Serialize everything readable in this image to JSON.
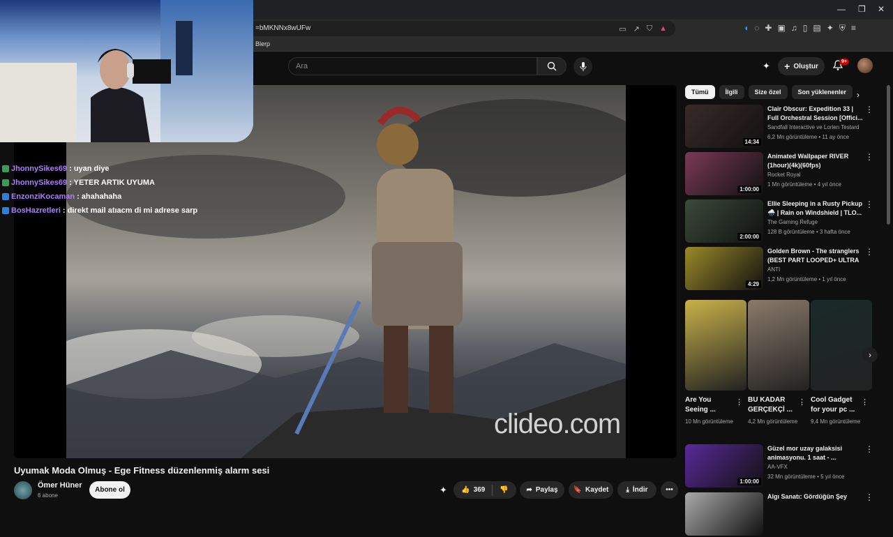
{
  "browser": {
    "url": "=bMKNNx8wUFw",
    "bookmark": "Blerp"
  },
  "header": {
    "search_placeholder": "Ara",
    "create_label": "Oluştur",
    "notification_count": "9+"
  },
  "chat": [
    {
      "user": "JhonnySikes69",
      "message": ": uyan diye",
      "badge_color": "#3b9b5b"
    },
    {
      "user": "JhonnySikes69",
      "message": ": YETER ARTIK UYUMA",
      "badge_color": "#3b9b5b"
    },
    {
      "user": "EnzonziKocaman",
      "message": ": ahahahaha",
      "badge_color": "#2f7fd6"
    },
    {
      "user": "BosHazretleri",
      "message": ": direkt mail atıacm di mi adrese sarp",
      "badge_color": "#2f7fd6"
    }
  ],
  "video": {
    "watermark": "clideo.com",
    "title": "Uyumak Moda Olmuş - Ege Fitness düzenlenmiş alarm sesi",
    "channel": "Ömer Hüner",
    "subscribers": "6 abone",
    "subscribe_label": "Abone ol",
    "likes": "369",
    "share_label": "Paylaş",
    "save_label": "Kaydet",
    "download_label": "İndir"
  },
  "sidebar": {
    "chips": [
      "Tümü",
      "İlgili",
      "Size özel",
      "Son yüklenenler"
    ],
    "recommendations": [
      {
        "title": "Clair Obscur: Expedition 33 | Full Orchestral Session [Offici...",
        "channel": "Sandfall Interactive ve Lorien Testard",
        "meta": "6,2 Mn görüntüleme • 11 ay önce",
        "duration": "14:34",
        "thumb_color": "#3a2a2a"
      },
      {
        "title": "Animated Wallpaper RIVER (1hour)(4k)(60fps)",
        "channel": "Rocket Royal",
        "meta": "1 Mn görüntüleme • 4 yıl önce",
        "duration": "1:00:00",
        "thumb_color": "#7a3a55"
      },
      {
        "title": "Ellie Sleeping in a Rusty Pickup 🌧️ | Rain on Windshield | TLO...",
        "channel": "The Gaming Refuge",
        "meta": "128 B görüntüleme • 3 hafta önce",
        "duration": "2:00:00",
        "thumb_color": "#3a4a3a"
      },
      {
        "title": "Golden Brown - The stranglers (BEST PART LOOPED+ ULTRA ...",
        "channel": "ANTI",
        "meta": "1,2 Mn görüntüleme • 1 yıl önce",
        "duration": "4:29",
        "thumb_color": "#9a8a2a"
      }
    ],
    "shorts": [
      {
        "title": "Are You Seeing ...",
        "views": "10 Mn görüntüleme",
        "thumb_color": "#c9b24a"
      },
      {
        "title": "BU KADAR GERÇEKÇİ ...",
        "views": "4,2 Mn görüntüleme",
        "thumb_color": "#8a7a6a"
      },
      {
        "title": "Cool Gadget for your pc ...",
        "views": "9,4 Mn görüntüleme",
        "thumb_color": "#1a2a2a"
      }
    ],
    "more_recommendations": [
      {
        "title": "Güzel mor uzay galaksisi animasyonu. 1 saat - ...",
        "channel": "AA-VFX",
        "meta": "32 Mn görüntüleme • 5 yıl önce",
        "duration": "1:00:00",
        "thumb_color": "#5a2a9a"
      },
      {
        "title": "Algı Sanatı: Gördüğün Şey",
        "channel": "",
        "meta": "",
        "duration": "",
        "thumb_color": "#aaa"
      }
    ]
  }
}
